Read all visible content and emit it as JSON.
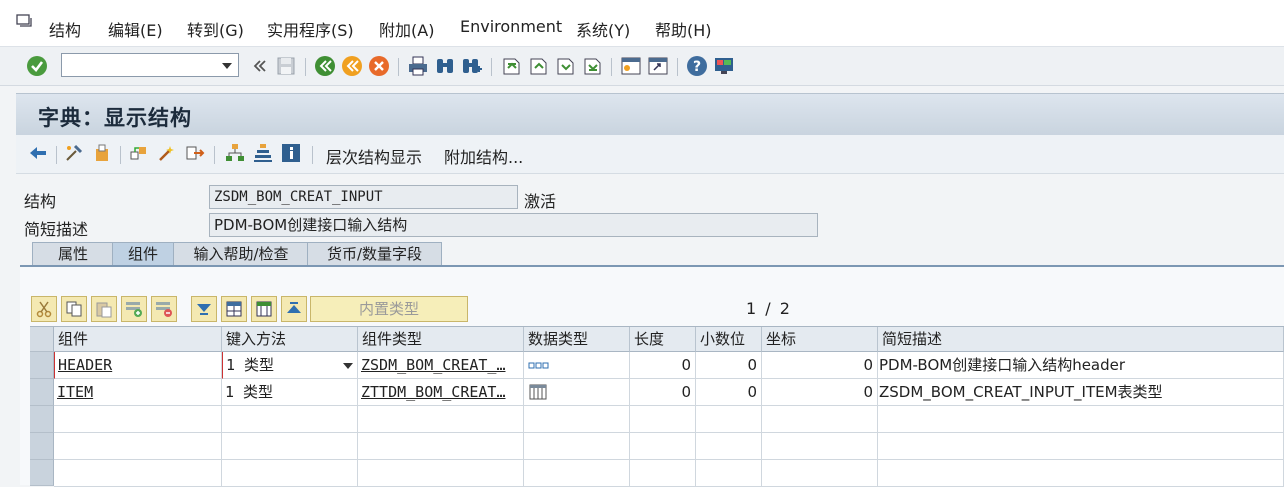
{
  "menu": {
    "items": [
      "结构",
      "编辑(E)",
      "转到(G)",
      "实用程序(S)",
      "附加(A)",
      "Environment",
      "系统(Y)",
      "帮助(H)"
    ]
  },
  "toolbar": {
    "command_value": "",
    "icons": [
      "enter-icon",
      "back-icon",
      "save-icon",
      "green-back-icon",
      "exit-icon",
      "cancel-icon",
      "print-icon",
      "find-icon",
      "find-next-icon",
      "first-page-icon",
      "prev-page-icon",
      "next-page-icon",
      "last-page-icon",
      "new-session-icon",
      "shortcut-icon",
      "help-icon",
      "layout-icon"
    ]
  },
  "title": "字典：显示结构",
  "app_toolbar": {
    "hierarchy_label": "层次结构显示",
    "append_label": "附加结构..."
  },
  "header": {
    "structure_label": "结构",
    "structure_value": "ZSDM_BOM_CREAT_INPUT",
    "status": "激活",
    "desc_label": "简短描述",
    "desc_value": "PDM-BOM创建接口输入结构"
  },
  "tabs": [
    {
      "label": "属性",
      "active": false
    },
    {
      "label": "组件",
      "active": true
    },
    {
      "label": "输入帮助/检查",
      "active": false
    },
    {
      "label": "货币/数量字段",
      "active": false
    }
  ],
  "table_toolbar": {
    "builtin_type_label": "内置类型",
    "page_current": "1",
    "page_sep": "/",
    "page_total": "2"
  },
  "grid": {
    "columns": [
      "组件",
      "键入方法",
      "组件类型",
      "数据类型",
      "长度",
      "小数位",
      "坐标",
      "简短描述"
    ],
    "rows": [
      {
        "component": "HEADER",
        "typing": "1 类型",
        "comp_type": "ZSDM_BOM_CREAT_…",
        "data_type_icon": "structure-icon",
        "length": "0",
        "decimals": "0",
        "coord": "0",
        "desc": "PDM-BOM创建接口输入结构header"
      },
      {
        "component": "ITEM",
        "typing": "1 类型",
        "comp_type": "ZTTDM_BOM_CREAT…",
        "data_type_icon": "table-type-icon",
        "length": "0",
        "decimals": "0",
        "coord": "0",
        "desc": "ZSDM_BOM_CREAT_INPUT_ITEM表类型"
      }
    ]
  }
}
